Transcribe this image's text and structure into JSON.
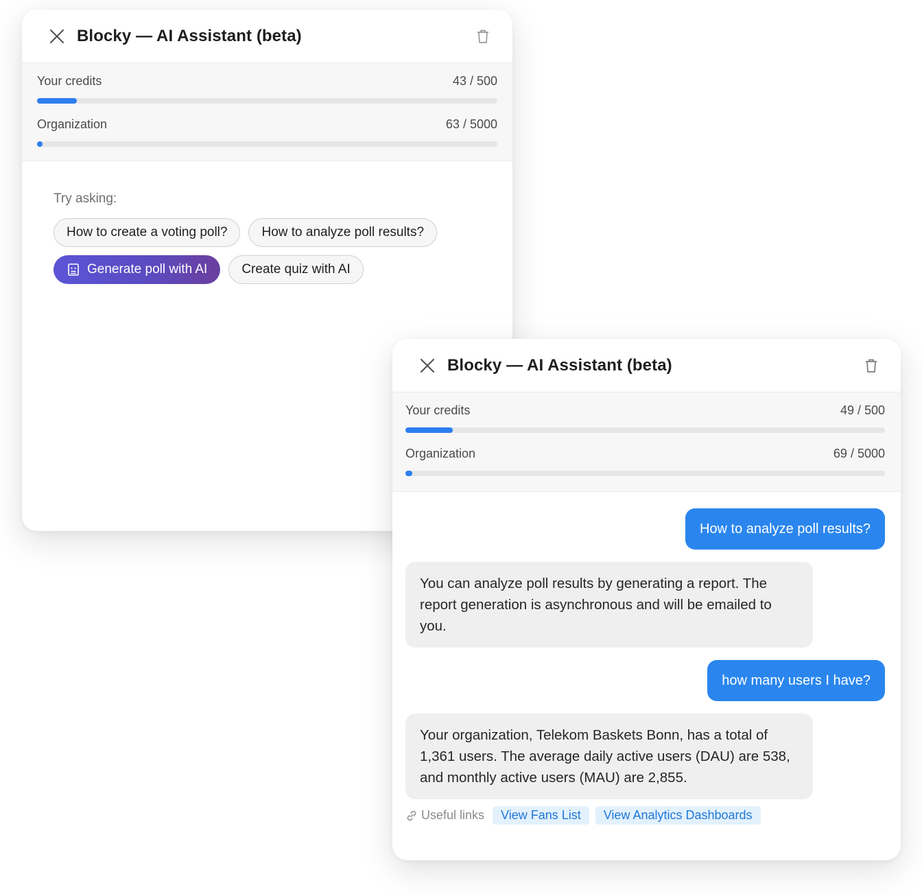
{
  "colors": {
    "accent": "#2a86ee",
    "progress": "#2d7ef0",
    "ai_gradient_start": "#5a55d6",
    "ai_gradient_end": "#6a3f9e",
    "link": "#1e78d9"
  },
  "panel_a": {
    "title": "Blocky — AI Assistant (beta)",
    "close_icon": "close-icon",
    "trash_icon": "trash-icon",
    "credits": {
      "your_label": "Your credits",
      "your_value": "43 / 500",
      "your_fraction": 0.086,
      "org_label": "Organization",
      "org_value": "63 / 5000",
      "org_fraction": 0.0126
    },
    "try_label": "Try asking:",
    "chips": [
      "How to create a voting poll?",
      "How to analyze poll results?",
      "Generate poll with AI",
      "Create quiz with AI"
    ]
  },
  "panel_b": {
    "title": "Blocky — AI Assistant (beta)",
    "close_icon": "close-icon",
    "trash_icon": "trash-icon",
    "credits": {
      "your_label": "Your credits",
      "your_value": "49 / 500",
      "your_fraction": 0.098,
      "org_label": "Organization",
      "org_value": "69 / 5000",
      "org_fraction": 0.0138
    },
    "messages": [
      {
        "role": "user",
        "text": "How to analyze poll results?"
      },
      {
        "role": "assistant",
        "text": "You can analyze poll results by generating a report. The report generation is asynchronous and will be emailed to you."
      },
      {
        "role": "user",
        "text": "how many users I have?"
      },
      {
        "role": "assistant",
        "text": "Your organization, Telekom Baskets Bonn, has a total of 1,361 users. The average daily active users (DAU) are 538, and monthly active users (MAU) are 2,855."
      }
    ],
    "useful_links_label": "Useful links",
    "links": [
      "View Fans List",
      "View Analytics Dashboards"
    ]
  }
}
